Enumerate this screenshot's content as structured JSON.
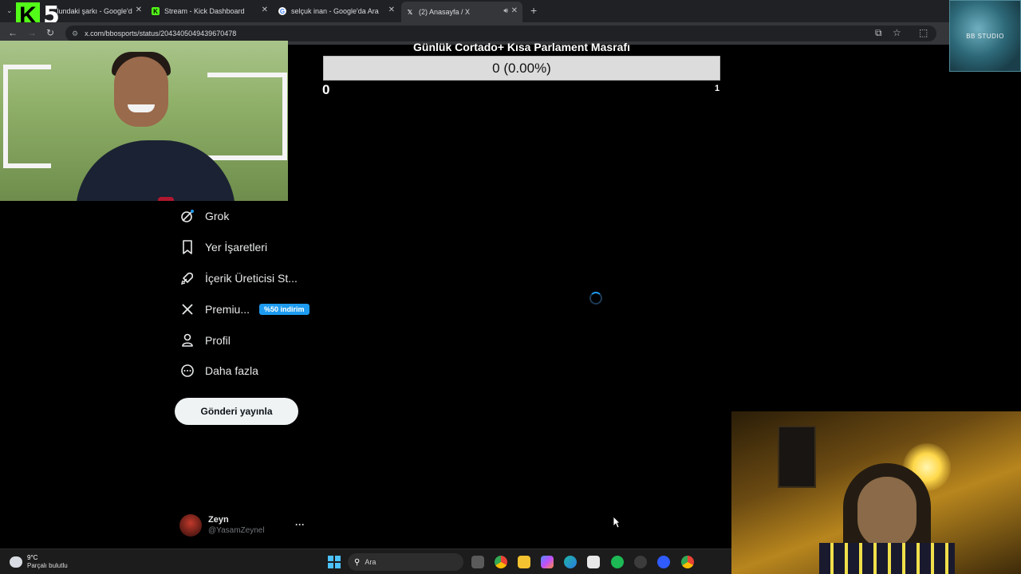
{
  "browser": {
    "tabs": [
      {
        "title": "...lundaki şarkı - Google'd",
        "favicon": "kick-icon"
      },
      {
        "title": "Stream - Kick Dashboard",
        "favicon": "kick-icon"
      },
      {
        "title": "selçuk inan - Google'da Ara",
        "favicon": "google-icon"
      },
      {
        "title": "(2) Anasayfa / X",
        "favicon": "x-icon",
        "active": true
      }
    ],
    "url": "x.com/bbosports/status/2043405049439670478"
  },
  "overlay": {
    "logo_k": "K",
    "logo_5": "5",
    "studio_badge": "BB STUDIO"
  },
  "goal": {
    "title": "Günlük Cortado+ Kısa Parlament Masrafı",
    "progress_text": "0 (0.00%)",
    "progress_fraction": 0,
    "min": "0",
    "max": "1",
    "fill_color": "#53fc18"
  },
  "sidebar": {
    "items": [
      {
        "label": "Grok",
        "icon": "grok-icon"
      },
      {
        "label": "Yer İşaretleri",
        "icon": "bookmark-icon"
      },
      {
        "label": "İçerik Üreticisi St...",
        "icon": "rocket-icon"
      },
      {
        "label": "Premiu...",
        "icon": "x-logo-icon",
        "badge": "%50 indirim"
      },
      {
        "label": "Profil",
        "icon": "person-icon"
      },
      {
        "label": "Daha fazla",
        "icon": "more-circle-icon"
      }
    ],
    "post_button": "Gönderi yayınla",
    "user": {
      "name": "Zeyn",
      "handle": "@YasamZeynel",
      "more": "···"
    }
  },
  "taskbar": {
    "weather_temp": "9°C",
    "weather_cond": "Parçalı bulutlu",
    "search_placeholder": "Ara"
  },
  "colors": {
    "accent": "#1d9bf0",
    "kick_green": "#53fc18",
    "background": "#000000"
  }
}
